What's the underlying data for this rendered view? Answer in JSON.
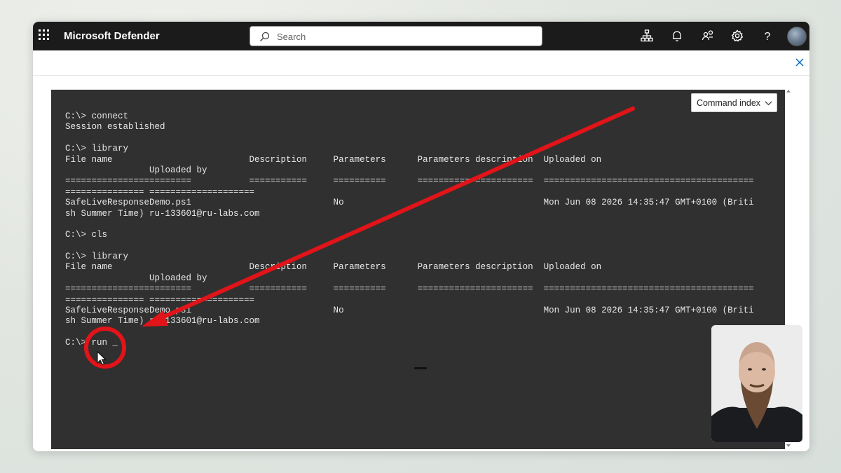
{
  "app": {
    "title": "Microsoft Defender"
  },
  "search": {
    "placeholder": "Search"
  },
  "header_icons": [
    "org-chart-icon",
    "bell-icon",
    "people-settings-icon",
    "gear-icon",
    "help-icon"
  ],
  "help_glyph": "?",
  "command_index": {
    "label": "Command index"
  },
  "console": {
    "lines": [
      "C:\\> connect",
      "Session established",
      "",
      "C:\\> library",
      "File name                          Description     Parameters      Parameters description  Uploaded on",
      "                Uploaded by",
      "========================           ===========     ==========      ======================  ========================================",
      "=============== ====================",
      "SafeLiveResponseDemo.ps1                           No                                      Mon Jun 08 2026 14:35:47 GMT+0100 (Briti",
      "sh Summer Time) ru-133601@ru-labs.com",
      "",
      "C:\\> cls",
      "",
      "C:\\> library",
      "File name                          Description     Parameters      Parameters description  Uploaded on",
      "                Uploaded by",
      "========================           ===========     ==========      ======================  ========================================",
      "=============== ====================",
      "SafeLiveResponseDemo.ps1                           No                                      Mon Jun 08 2026 14:35:47 GMT+0100 (Briti",
      "sh Summer Time) ru-133601@ru-labs.com",
      "",
      "C:\\> run _"
    ]
  },
  "colors": {
    "topbar": "#1b1b1b",
    "console_bg": "#303030",
    "console_text": "#e8e8e8",
    "annotation": "#e01419",
    "accent": "#0f6cbd"
  }
}
